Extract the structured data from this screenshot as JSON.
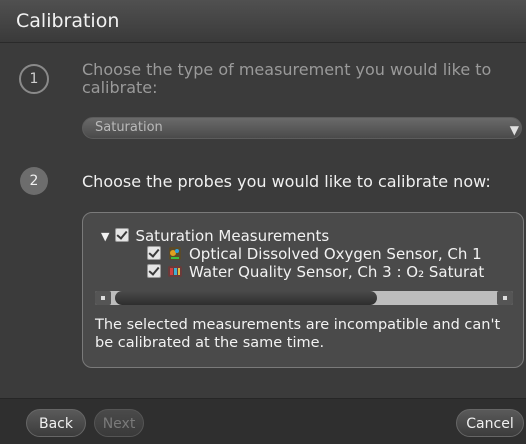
{
  "window": {
    "title": "Calibration"
  },
  "step1": {
    "number": "1",
    "text": "Choose the type of measurement you would like to calibrate:",
    "dropdown_value": "Saturation"
  },
  "step2": {
    "number": "2",
    "text": "Choose the probes you would like to calibrate now:"
  },
  "probe_tree": {
    "group": {
      "label": "Saturation Measurements",
      "checked": true,
      "expanded": true
    },
    "items": [
      {
        "label": "Optical Dissolved Oxygen Sensor, Ch 1",
        "checked": true,
        "icon": "optical-do-sensor-icon"
      },
      {
        "label": "Water Quality Sensor, Ch 3 : O₂ Saturat",
        "checked": true,
        "icon": "water-quality-sensor-icon"
      }
    ],
    "warning": "The selected measurements are incompatible and can't be calibrated at the same time."
  },
  "footer": {
    "back_label": "Back",
    "next_label": "Next",
    "cancel_label": "Cancel"
  },
  "colors": {
    "background": "#3b3b3b",
    "text": "#f2f2f2",
    "disabled_text": "#7a7a7a"
  }
}
